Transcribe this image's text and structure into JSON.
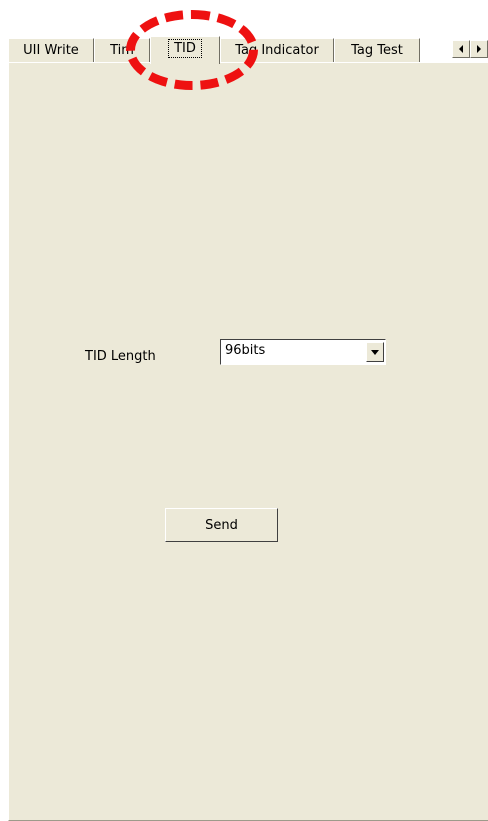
{
  "tabs": [
    {
      "label": "UII Write",
      "active": false
    },
    {
      "label": "Tim",
      "active": false
    },
    {
      "label": "TID",
      "active": true
    },
    {
      "label": "Tag Indicator",
      "active": false
    },
    {
      "label": "Tag Test",
      "active": false
    }
  ],
  "tab_scroll": {
    "left_icon": "arrow-left-icon",
    "right_icon": "arrow-right-icon"
  },
  "tid_panel": {
    "tid_length_label": "TID Length",
    "tid_length_value": "96bits",
    "send_label": "Send"
  },
  "annotation": {
    "type": "red dashed circle highlighting the TID tab",
    "color": "#ee1111"
  }
}
